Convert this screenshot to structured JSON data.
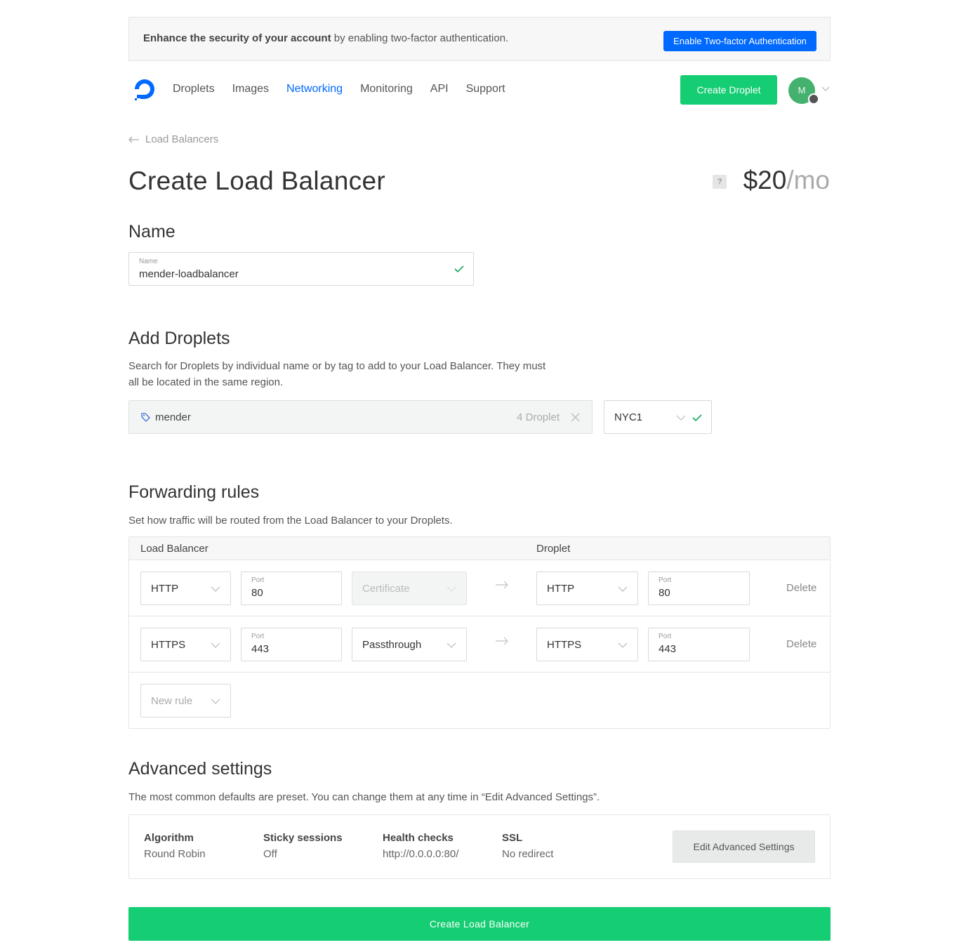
{
  "banner": {
    "bold_text": "Enhance the security of your account",
    "text": " by enabling two-factor authentication.",
    "button_label": "Enable Two-factor Authentication"
  },
  "nav": {
    "items": [
      "Droplets",
      "Images",
      "Networking",
      "Monitoring",
      "API",
      "Support"
    ],
    "active": "Networking",
    "create_button": "Create Droplet",
    "avatar_initial": "M"
  },
  "back_link": "Load Balancers",
  "page_title": "Create Load Balancer",
  "price": {
    "amount": "$20",
    "period": "/mo",
    "help": "?"
  },
  "name_section": {
    "title": "Name",
    "field_label": "Name",
    "field_value": "mender-loadbalancer"
  },
  "droplets_section": {
    "title": "Add Droplets",
    "description_line1": "Search for Droplets by individual name or by tag to add to your Load Balancer. They must",
    "description_line2": "all be located in the same region.",
    "tag": "mender",
    "count": "4 Droplet",
    "region": "NYC1"
  },
  "forwarding": {
    "title": "Forwarding rules",
    "description": "Set how traffic will be routed from the Load Balancer to your Droplets.",
    "header_lb": "Load Balancer",
    "header_droplet": "Droplet",
    "port_label": "Port",
    "delete_label": "Delete",
    "rules": [
      {
        "lb_protocol": "HTTP",
        "lb_port": "80",
        "certificate": "Certificate",
        "droplet_protocol": "HTTP",
        "droplet_port": "80"
      },
      {
        "lb_protocol": "HTTPS",
        "lb_port": "443",
        "certificate": "Passthrough",
        "droplet_protocol": "HTTPS",
        "droplet_port": "443"
      }
    ],
    "new_rule": "New rule"
  },
  "advanced": {
    "title": "Advanced settings",
    "description": "The most common defaults are preset. You can change them at any time in “Edit Advanced Settings”.",
    "columns": [
      {
        "heading": "Algorithm",
        "value": "Round Robin"
      },
      {
        "heading": "Sticky sessions",
        "value": "Off"
      },
      {
        "heading": "Health checks",
        "value": "http://0.0.0.0:80/"
      },
      {
        "heading": "SSL",
        "value": "No redirect"
      }
    ],
    "edit_button": "Edit Advanced Settings"
  },
  "create_button": "Create Load Balancer",
  "colors": {
    "brand_blue": "#0069ff",
    "green": "#15cd72"
  }
}
